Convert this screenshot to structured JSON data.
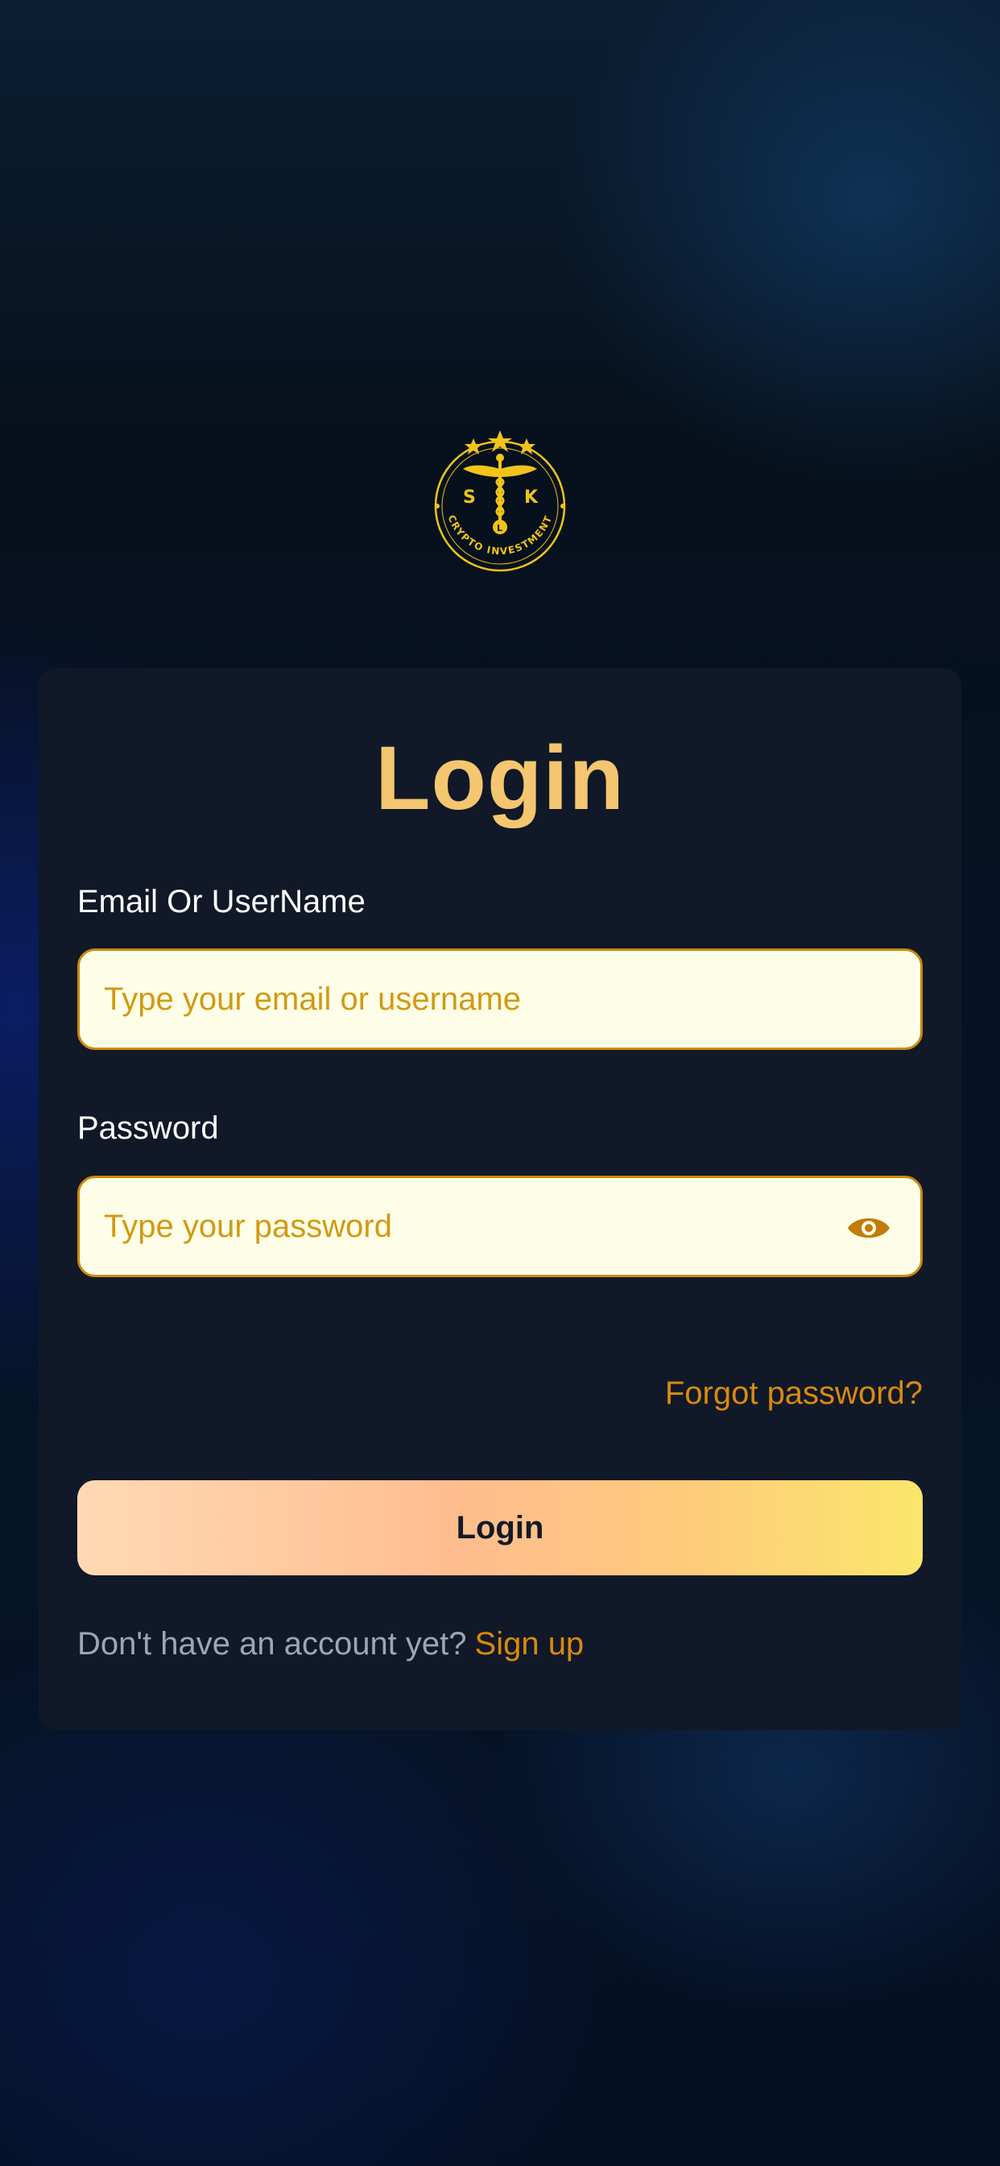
{
  "brand": {
    "logo_initials_left": "S",
    "logo_initials_right": "K",
    "logo_initial_center": "L",
    "logo_ring_text": "CRYPTO INVESTMENT",
    "gold": "#f0c419"
  },
  "login_card": {
    "title": "Login",
    "email": {
      "label": "Email Or UserName",
      "placeholder": "Type your email or username",
      "value": ""
    },
    "password": {
      "label": "Password",
      "placeholder": "Type your password",
      "value": "",
      "toggle_icon": "eye-icon"
    },
    "forgot_password_label": "Forgot password?",
    "submit_label": "Login",
    "signup_prompt": "Don't have an account yet?",
    "signup_link_label": "Sign up"
  },
  "colors": {
    "title": "#f4c66f",
    "input_background": "#fefee8",
    "input_border": "#c98a0a",
    "placeholder": "#d19a12",
    "link": "#d88a10",
    "card_background": "#111827"
  }
}
